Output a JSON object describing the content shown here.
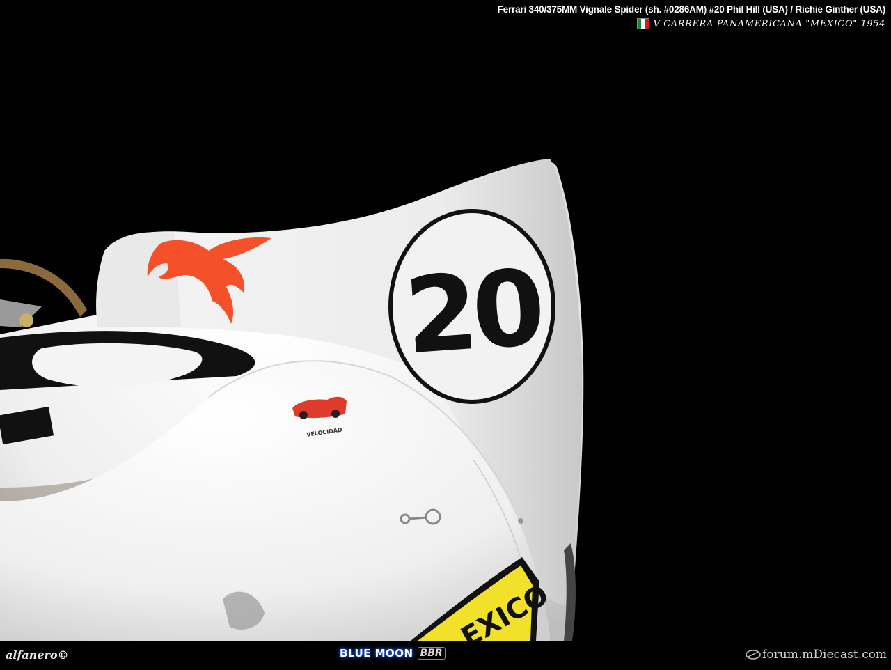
{
  "caption": {
    "line1": "Ferrari 340/375MM Vignale Spider (sh. #0286AM)   #20  Phil Hill (USA) / Richie Ginther (USA)",
    "line2": "V CARRERA PANAMERICANA \"MEXICO\" 1954"
  },
  "car": {
    "race_number": "20",
    "partial_number": "0",
    "decal_caption": "VELOCIDAD",
    "plate_text": "EXICO"
  },
  "footer": {
    "left": "alfanero©",
    "middle": "BLUE MOON",
    "middle_badge": "BBR",
    "right": "forum.mDiecast.com"
  },
  "colors": {
    "background": "#000000",
    "body_white": "#f2f2f2",
    "pegasus_red": "#f4502a",
    "number_black": "#111111",
    "plate_yellow": "#f2e12a",
    "flag_green": "#1a8a3a",
    "flag_white": "#ffffff",
    "flag_red": "#c8202a"
  },
  "icons": [
    "mexico-flag-icon",
    "pegasus-logo",
    "forum-logo-icon"
  ]
}
